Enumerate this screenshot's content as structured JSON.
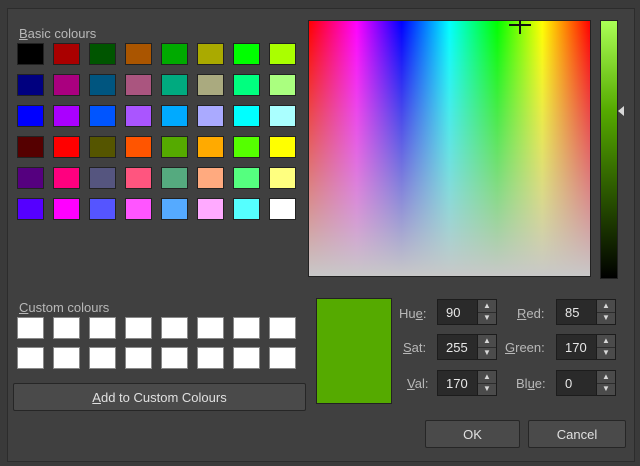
{
  "basic_colours": {
    "label_first": "B",
    "label_rest": "asic colours",
    "swatches": [
      "#000000",
      "#aa0000",
      "#005500",
      "#aa5500",
      "#00aa00",
      "#aaaa00",
      "#00ff00",
      "#aaff00",
      "#00007f",
      "#aa007f",
      "#00557f",
      "#aa557f",
      "#00aa7f",
      "#aaaa7f",
      "#00ff7f",
      "#aaff7f",
      "#0000ff",
      "#aa00ff",
      "#0055ff",
      "#aa55ff",
      "#00aaff",
      "#aaaaff",
      "#00ffff",
      "#aaffff",
      "#550000",
      "#ff0000",
      "#555500",
      "#ff5500",
      "#55aa00",
      "#ffaa00",
      "#55ff00",
      "#ffff00",
      "#55007f",
      "#ff007f",
      "#55557f",
      "#ff557f",
      "#55aa7f",
      "#ffaa7f",
      "#55ff7f",
      "#ffff7f",
      "#5500ff",
      "#ff00ff",
      "#5555ff",
      "#ff55ff",
      "#55aaff",
      "#ffaaff",
      "#55ffff",
      "#ffffff"
    ]
  },
  "custom_colours": {
    "label_first": "C",
    "label_rest": "ustom colours",
    "count": 16,
    "add_button_first": "A",
    "add_button_rest": "dd to Custom Colours"
  },
  "current_color": "#55aa00",
  "fields": {
    "hue": {
      "label_pre": "Hu",
      "label_u": "e",
      "label_post": ":",
      "value": "90"
    },
    "sat": {
      "label_pre": "",
      "label_u": "S",
      "label_post": "at:",
      "value": "255"
    },
    "val": {
      "label_pre": "",
      "label_u": "V",
      "label_post": "al:",
      "value": "170"
    },
    "red": {
      "label_pre": "",
      "label_u": "R",
      "label_post": "ed:",
      "value": "85"
    },
    "green": {
      "label_pre": "",
      "label_u": "G",
      "label_post": "reen:",
      "value": "170"
    },
    "blue": {
      "label_pre": "Bl",
      "label_u": "u",
      "label_post": "e:",
      "value": "0"
    }
  },
  "buttons": {
    "ok": "OK",
    "cancel": "Cancel"
  },
  "spin_icons": {
    "up": "▲",
    "down": "▼"
  }
}
